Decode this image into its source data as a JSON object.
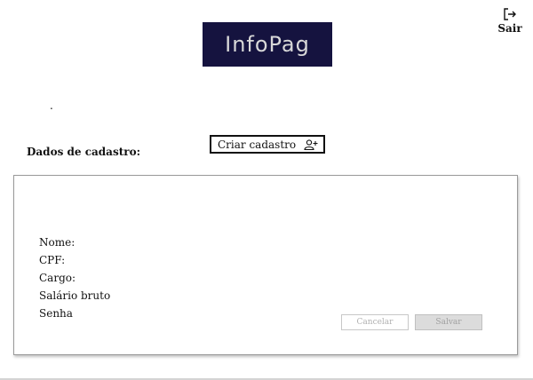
{
  "header": {
    "logo_text": "InfoPag",
    "logout_label": "Sair",
    "logout_icon": "logout-icon"
  },
  "main": {
    "dot_text": ".",
    "section_title": "Dados de cadastro:",
    "create_button": {
      "label": "Criar cadastro",
      "icon": "add-user-icon"
    }
  },
  "form": {
    "fields": [
      {
        "label": "Nome:"
      },
      {
        "label": "CPF:"
      },
      {
        "label": "Cargo:"
      },
      {
        "label": "Salário bruto"
      },
      {
        "label": "Senha"
      }
    ],
    "cancel_label": "Cancelar",
    "save_label": "Salvar"
  },
  "colors": {
    "logo_background": "#15133f",
    "logo_text": "#d8d8d8"
  }
}
